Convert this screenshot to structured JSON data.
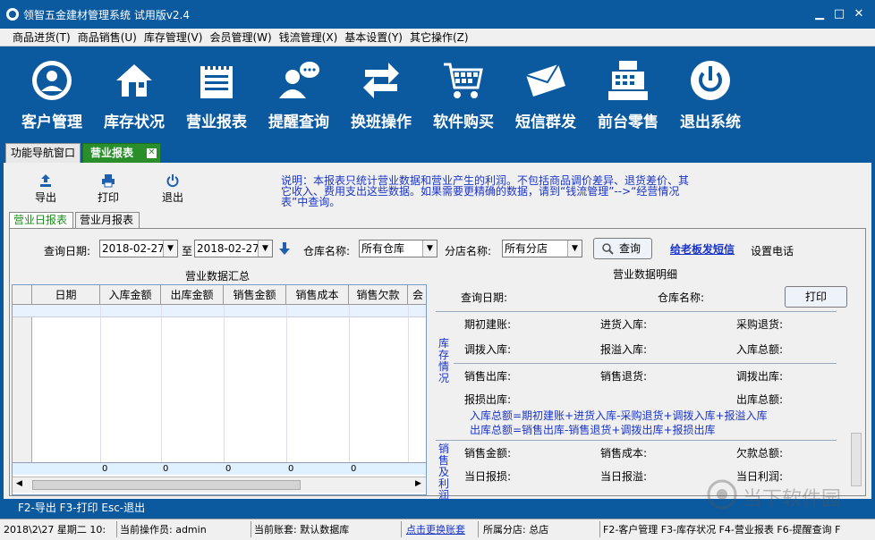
{
  "window": {
    "title": "领智五金建材管理系统 试用版v2.4",
    "min": "▁",
    "max": "□",
    "close": "✕"
  },
  "menu": [
    "商品进货(T)",
    "商品销售(U)",
    "库存管理(V)",
    "会员管理(W)",
    "钱流管理(X)",
    "基本设置(Y)",
    "其它操作(Z)"
  ],
  "toolbar": [
    {
      "label": "客户管理",
      "icon": "customer-icon"
    },
    {
      "label": "库存状况",
      "icon": "house-icon"
    },
    {
      "label": "营业报表",
      "icon": "report-icon"
    },
    {
      "label": "提醒查询",
      "icon": "chat-user-icon"
    },
    {
      "label": "换班操作",
      "icon": "swap-arrows-icon"
    },
    {
      "label": "软件购买",
      "icon": "cart-icon"
    },
    {
      "label": "短信群发",
      "icon": "envelope-icon"
    },
    {
      "label": "前台零售",
      "icon": "cash-register-icon"
    },
    {
      "label": "退出系统",
      "icon": "power-icon"
    }
  ],
  "tabs": {
    "nav": "功能导航窗口",
    "active": "营业报表",
    "close": "✕"
  },
  "actions": {
    "export": "导出",
    "print": "打印",
    "exit": "退出"
  },
  "note": "说明：本报表只统计营业数据和营业产生的利润。不包括商品调价差异、退货差价、其它收入、费用支出这些数据。如果需要更精确的数据，请到“钱流管理”-->“经营情况表”中查询。",
  "subtabs": {
    "daily": "营业日报表",
    "monthly": "营业月报表"
  },
  "query": {
    "date_label": "查询日期:",
    "date_from": "2018-02-27",
    "to": "至",
    "date_to": "2018-02-27",
    "warehouse_label": "仓库名称:",
    "warehouse": "所有仓库",
    "branch_label": "分店名称:",
    "branch": "所有分店",
    "search": "查询",
    "send_link": "给老板发短信",
    "phone": "设置电话"
  },
  "summary": {
    "title": "营业数据汇总",
    "columns": [
      "日期",
      "入库金额",
      "出库金额",
      "销售金额",
      "销售成本",
      "销售欠款",
      "会"
    ],
    "totals": [
      "",
      "0",
      "0",
      "0",
      "0",
      "0",
      ""
    ]
  },
  "detail": {
    "title": "营业数据明细",
    "query_date": "查询日期:",
    "warehouse": "仓库名称:",
    "print": "打印",
    "stock_side": "库存情况",
    "stock_rows": [
      [
        "期初建账:",
        "进货入库:",
        "采购退货:"
      ],
      [
        "调拨入库:",
        "报溢入库:",
        "入库总额:"
      ],
      [
        "销售出库:",
        "销售退货:",
        "调拨出库:"
      ],
      [
        "报损出库:",
        "",
        "出库总额:"
      ]
    ],
    "formula_in": "入库总额=期初建账+进货入库-采购退货+调拨入库+报溢入库",
    "formula_out": "出库总额=销售出库-销售退货+调拨出库+报损出库",
    "sales_side": "销售及利润",
    "sales_rows": [
      [
        "销售金额:",
        "销售成本:",
        "欠款总额:"
      ],
      [
        "当日报损:",
        "当日报溢:",
        "当日利润:"
      ]
    ]
  },
  "fkeys": "F2-导出 F3-打印 Esc-退出",
  "status": {
    "datetime": "2018\\2\\27 星期二 10:",
    "operator": "当前操作员: admin",
    "account": "当前账套: 默认数据库",
    "change": "点击更换账套",
    "branch": "所属分店: 总店",
    "hotkeys": "F2-客户管理 F3-库存状况 F4-营业报表 F6-提醒查询 F"
  },
  "watermark": "当下软件园",
  "colors": {
    "titlebar": "#0b5aa0",
    "active_tab": "#2a8f2a",
    "note": "#1a34c8"
  }
}
